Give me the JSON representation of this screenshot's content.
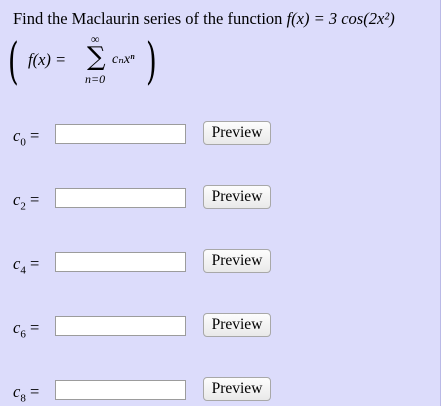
{
  "question": {
    "intro": "Find the Maclaurin series of the function ",
    "function": "f(x) = 3 cos(2x²)"
  },
  "formula": {
    "lhs": "f(x) =",
    "sum_upper": "∞",
    "sum_symbol": "∑",
    "sum_lower": "n=0",
    "term": "cₙxⁿ"
  },
  "coefficients": [
    {
      "label": "c",
      "subscript": "0",
      "equals": "=",
      "value": "",
      "button": "Preview"
    },
    {
      "label": "c",
      "subscript": "2",
      "equals": "=",
      "value": "",
      "button": "Preview"
    },
    {
      "label": "c",
      "subscript": "4",
      "equals": "=",
      "value": "",
      "button": "Preview"
    },
    {
      "label": "c",
      "subscript": "6",
      "equals": "=",
      "value": "",
      "button": "Preview"
    },
    {
      "label": "c",
      "subscript": "8",
      "equals": "=",
      "value": "",
      "button": "Preview"
    }
  ],
  "colors": {
    "background": "#dcdcfb",
    "input_border": "#9c9c9c"
  }
}
